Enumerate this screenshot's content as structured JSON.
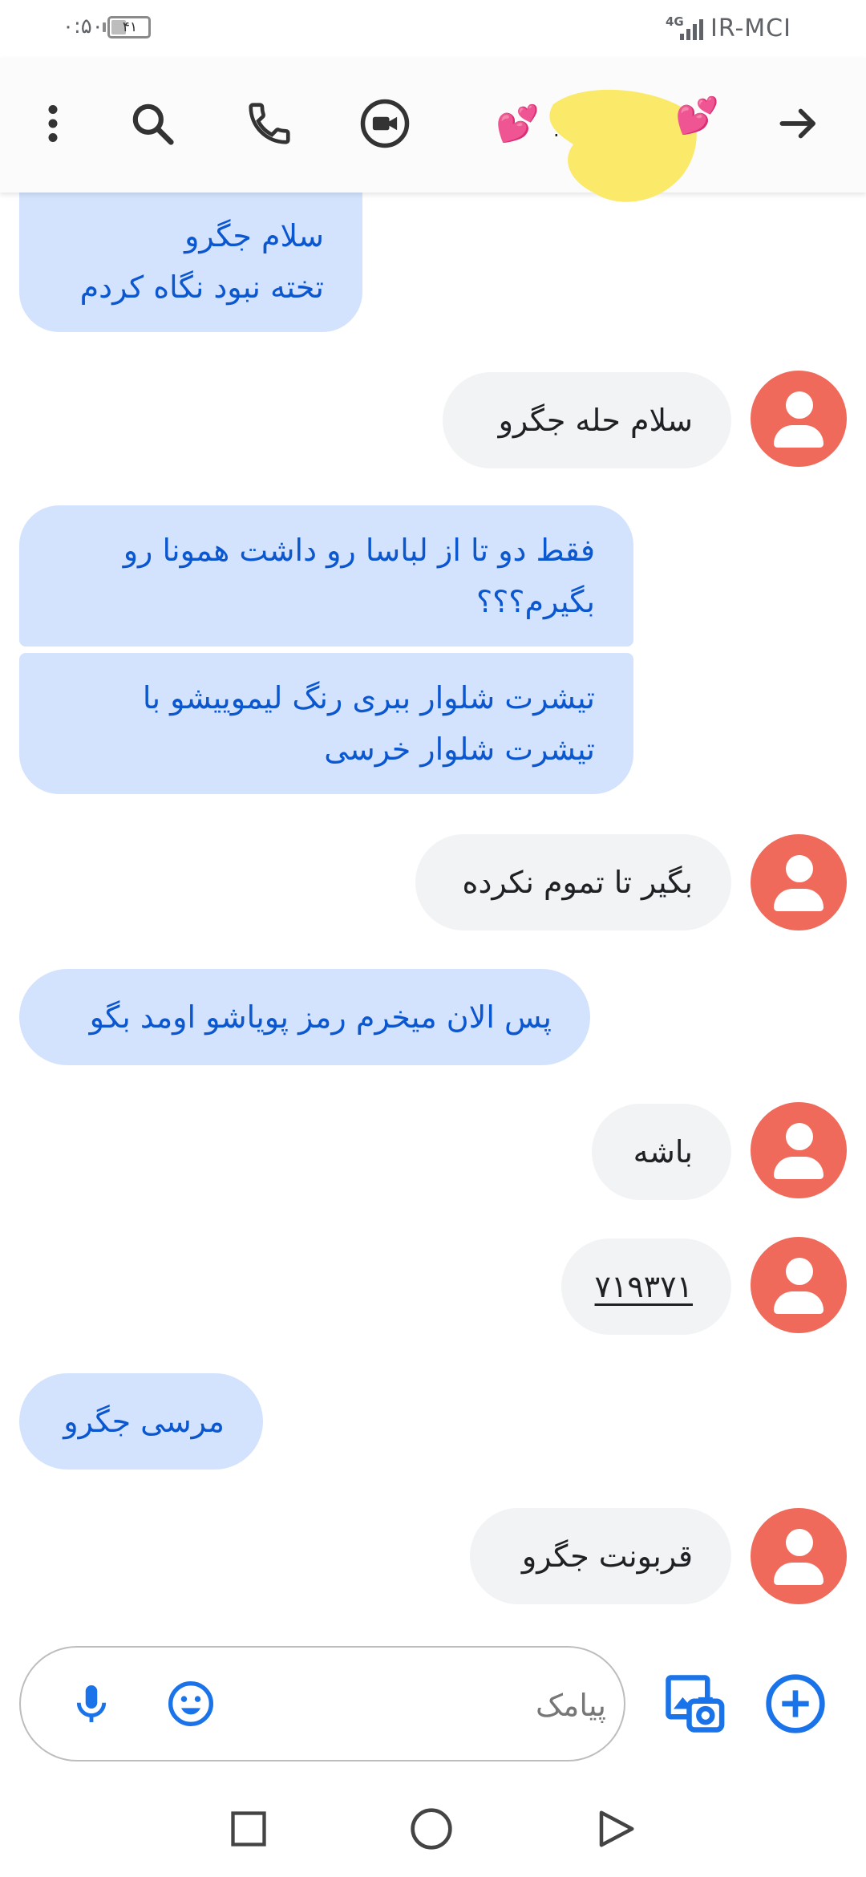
{
  "status_bar": {
    "time": "۰:۵۰",
    "battery_level": 0.41,
    "battery_text": "۴۱",
    "network": "4G",
    "carrier": "IR-MCI"
  },
  "app_bar": {
    "icons": [
      "more-vert-icon",
      "search-icon",
      "phone-icon",
      "video-call-icon",
      "arrow-forward-icon"
    ],
    "contact_hearts_left": "💕",
    "contact_hearts_right": "💕",
    "contact_name": "."
  },
  "messages": [
    {
      "dir": "incoming",
      "lines": [
        "سلام جگرو",
        "تخته نبود نگاه کردم"
      ]
    },
    {
      "dir": "outgoing",
      "text": "سلام حله جگرو"
    },
    {
      "dir": "incoming",
      "lines": [
        "فقط دو تا از لباسا رو داشت همونا رو",
        "بگیرم؟؟؟"
      ]
    },
    {
      "dir": "incoming",
      "lines": [
        "تیشرت شلوار ببری رنگ لیموییشو با",
        "تیشرت شلوار خرسی"
      ]
    },
    {
      "dir": "outgoing",
      "text": "بگیر تا تموم نکرده"
    },
    {
      "dir": "incoming",
      "lines": [
        "پس الان میخرم رمز پویاشو اومد بگو"
      ]
    },
    {
      "dir": "outgoing",
      "text": "باشه"
    },
    {
      "dir": "outgoing",
      "text": "۷۱۹۳۷۱"
    },
    {
      "dir": "incoming",
      "lines": [
        "مرسی جگرو"
      ]
    },
    {
      "dir": "outgoing",
      "text": "قربونت جگرو"
    }
  ],
  "compose": {
    "placeholder": "پیامک",
    "icons": [
      "mic-icon",
      "emoji-icon",
      "gallery-icon",
      "add-icon"
    ]
  },
  "colors": {
    "incoming_bubble": "#d3e3fd",
    "incoming_text": "#0b57d0",
    "outgoing_bubble": "#f1f3f4",
    "avatar": "#ef6a5a",
    "accent": "#1a73e8"
  }
}
